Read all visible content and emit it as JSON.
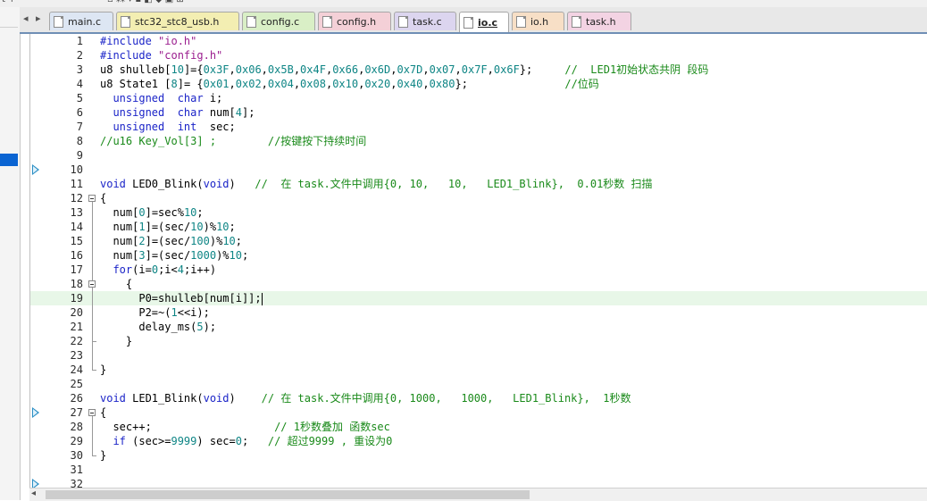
{
  "toolbar": {
    "fragment": "t +"
  },
  "tabs": [
    {
      "label": "main.c",
      "color": "#dde6f3",
      "active": false
    },
    {
      "label": "stc32_stc8_usb.h",
      "color": "#f3eeb2",
      "active": false
    },
    {
      "label": "config.c",
      "color": "#d9efc6",
      "active": false
    },
    {
      "label": "config.h",
      "color": "#f4d0d7",
      "active": false
    },
    {
      "label": "task.c",
      "color": "#dcd5ef",
      "active": false
    },
    {
      "label": "io.c",
      "color": "#ffffff",
      "active": true
    },
    {
      "label": "io.h",
      "color": "#f7dfc6",
      "active": false
    },
    {
      "label": "task.h",
      "color": "#f3d3e3",
      "active": false
    }
  ],
  "editor": {
    "current_line": 19,
    "lines": [
      {
        "n": "1",
        "t": "#include \"io.h\""
      },
      {
        "n": "2",
        "t": "#include \"config.h\""
      },
      {
        "n": "3",
        "t": "u8 shulleb[10]={0x3F,0x06,0x5B,0x4F,0x66,0x6D,0x7D,0x07,0x7F,0x6F};     //  LED1初始状态共阴 段码"
      },
      {
        "n": "4",
        "t": "u8 State1 [8]= {0x01,0x02,0x04,0x08,0x10,0x20,0x40,0x80};               //位码"
      },
      {
        "n": "5",
        "t": "  unsigned  char i;"
      },
      {
        "n": "6",
        "t": "  unsigned  char num[4];"
      },
      {
        "n": "7",
        "t": "  unsigned  int  sec;"
      },
      {
        "n": "8",
        "t": "//u16 Key_Vol[3] ;        //按键按下持续时间"
      },
      {
        "n": "9",
        "t": ""
      },
      {
        "n": "10",
        "t": ""
      },
      {
        "n": "11",
        "t": "void LED0_Blink(void)   //  在 task.文件中调用{0, 10,   10,   LED1_Blink},  0.01秒数 扫描"
      },
      {
        "n": "12",
        "t": "{"
      },
      {
        "n": "13",
        "t": "  num[0]=sec%10;"
      },
      {
        "n": "14",
        "t": "  num[1]=(sec/10)%10;"
      },
      {
        "n": "15",
        "t": "  num[2]=(sec/100)%10;"
      },
      {
        "n": "16",
        "t": "  num[3]=(sec/1000)%10;"
      },
      {
        "n": "17",
        "t": "  for(i=0;i<4;i++)"
      },
      {
        "n": "18",
        "t": "    {"
      },
      {
        "n": "19",
        "t": "      P0=shulleb[num[i]];"
      },
      {
        "n": "20",
        "t": "      P2=~(1<<i);"
      },
      {
        "n": "21",
        "t": "      delay_ms(5);"
      },
      {
        "n": "22",
        "t": "    }"
      },
      {
        "n": "23",
        "t": ""
      },
      {
        "n": "24",
        "t": "}"
      },
      {
        "n": "25",
        "t": ""
      },
      {
        "n": "26",
        "t": "void LED1_Blink(void)    // 在 task.文件中调用{0, 1000,   1000,   LED1_Blink},  1秒数"
      },
      {
        "n": "27",
        "t": "{"
      },
      {
        "n": "28",
        "t": "  sec++;                   // 1秒数叠加 函数sec"
      },
      {
        "n": "29",
        "t": "  if (sec>=9999) sec=0;   // 超过9999 , 重设为0"
      },
      {
        "n": "30",
        "t": "}"
      },
      {
        "n": "31",
        "t": ""
      },
      {
        "n": "32",
        "t": ""
      }
    ]
  }
}
